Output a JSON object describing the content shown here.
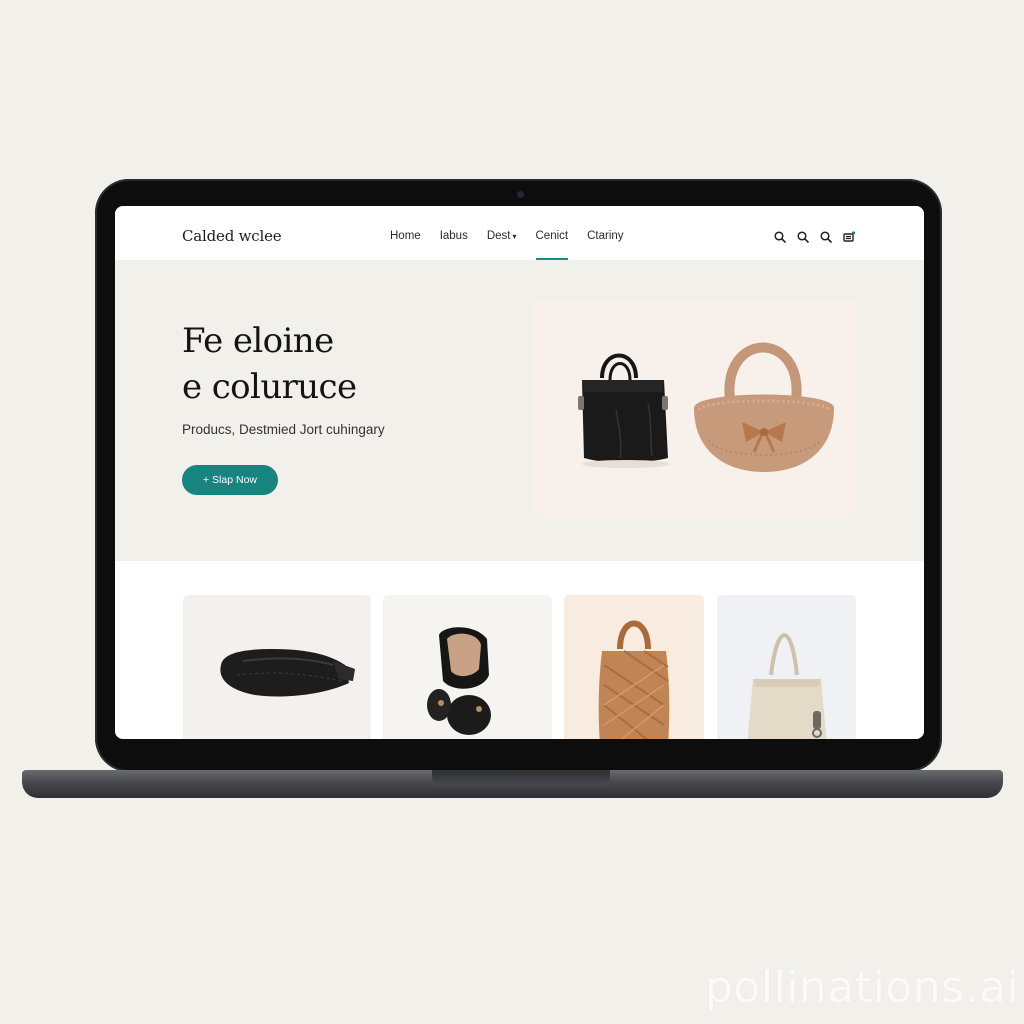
{
  "site": {
    "logo": "Calded wclee",
    "nav": [
      {
        "label": "Home",
        "active": false,
        "has_caret": false
      },
      {
        "label": "Iabus",
        "active": false,
        "has_caret": false
      },
      {
        "label": "Dest",
        "active": false,
        "has_caret": true
      },
      {
        "label": "Cenict",
        "active": true,
        "has_caret": false
      },
      {
        "label": "Ctariny",
        "active": false,
        "has_caret": false
      }
    ],
    "header_icons": [
      "search-icon",
      "search-icon",
      "search-icon",
      "cart-icon"
    ],
    "accent_color": "#17847f"
  },
  "hero": {
    "title_line1": "Fe eloine",
    "title_line2": "e coluruce",
    "subtitle": "Producs, Destmied Jort cuhingary",
    "cta_label": "+ Slap Now"
  },
  "watermark": "pollinations.ai"
}
